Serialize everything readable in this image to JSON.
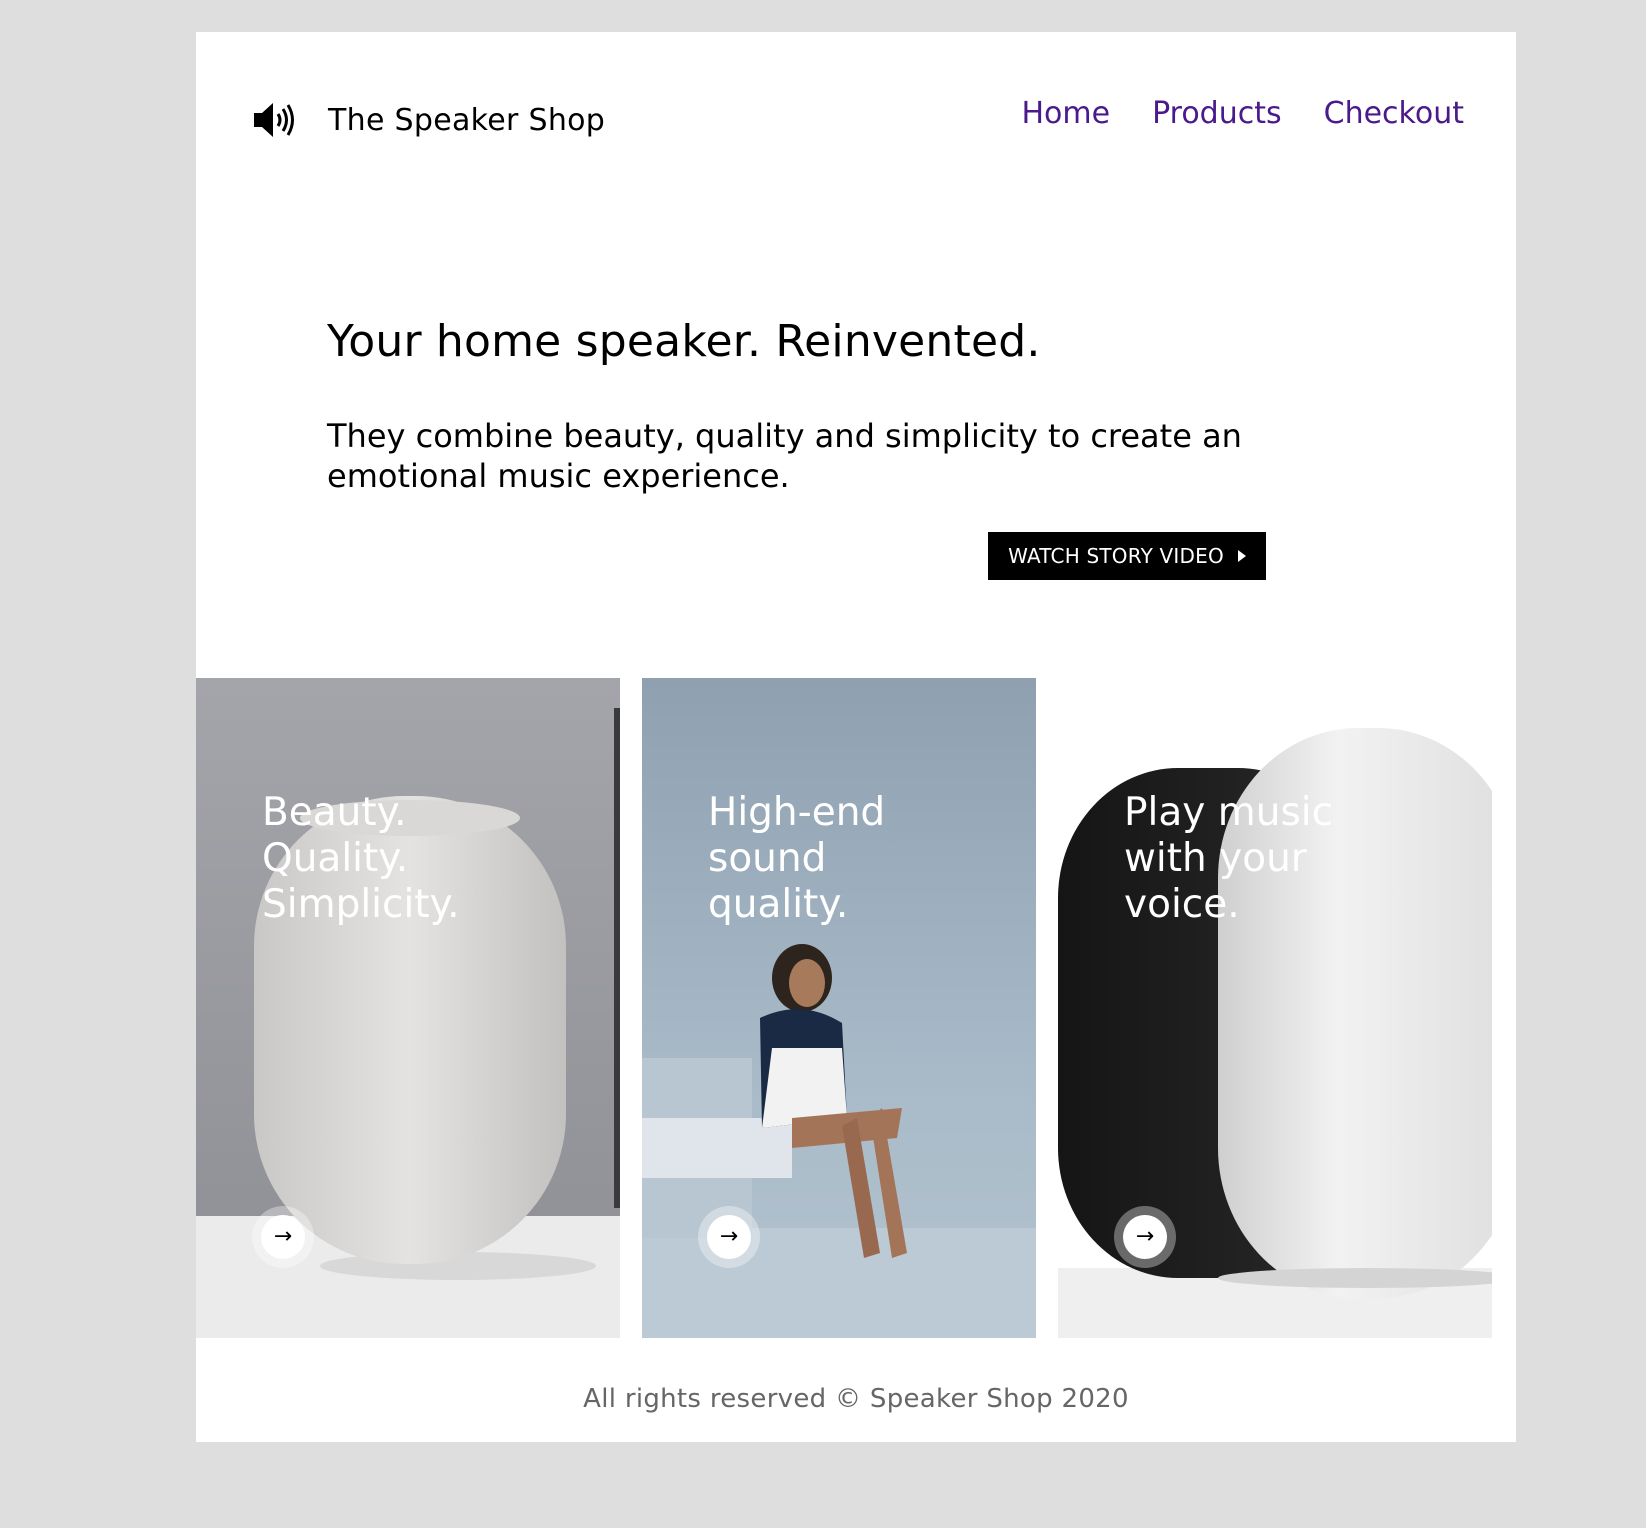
{
  "header": {
    "brand": "The Speaker Shop",
    "logo_icon": "speaker-volume-icon",
    "nav": [
      "Home",
      "Products",
      "Checkout"
    ],
    "nav_color": "#4a1a8c"
  },
  "hero": {
    "title": "Your home speaker. Reinvented.",
    "subtitle": "They combine beauty, quality and simplicity to create an emotional music experience.",
    "cta_label": "WATCH STORY VIDEO",
    "cta_icon": "play-icon"
  },
  "cards": [
    {
      "title": "Beauty. Quality. Simplicity.",
      "lines": [
        "Beauty.",
        "Quality.",
        "Simplicity."
      ],
      "arrow_icon": "arrow-right-icon"
    },
    {
      "title": "High-end sound quality.",
      "lines": [
        "High-end",
        "sound",
        "quality."
      ],
      "arrow_icon": "arrow-right-icon"
    },
    {
      "title": "Play music with your voice.",
      "lines": [
        "Play music",
        "with your",
        "voice."
      ],
      "arrow_icon": "arrow-right-icon"
    }
  ],
  "arrow_glyph": "→",
  "footer": {
    "text": "All rights reserved © Speaker Shop 2020"
  }
}
